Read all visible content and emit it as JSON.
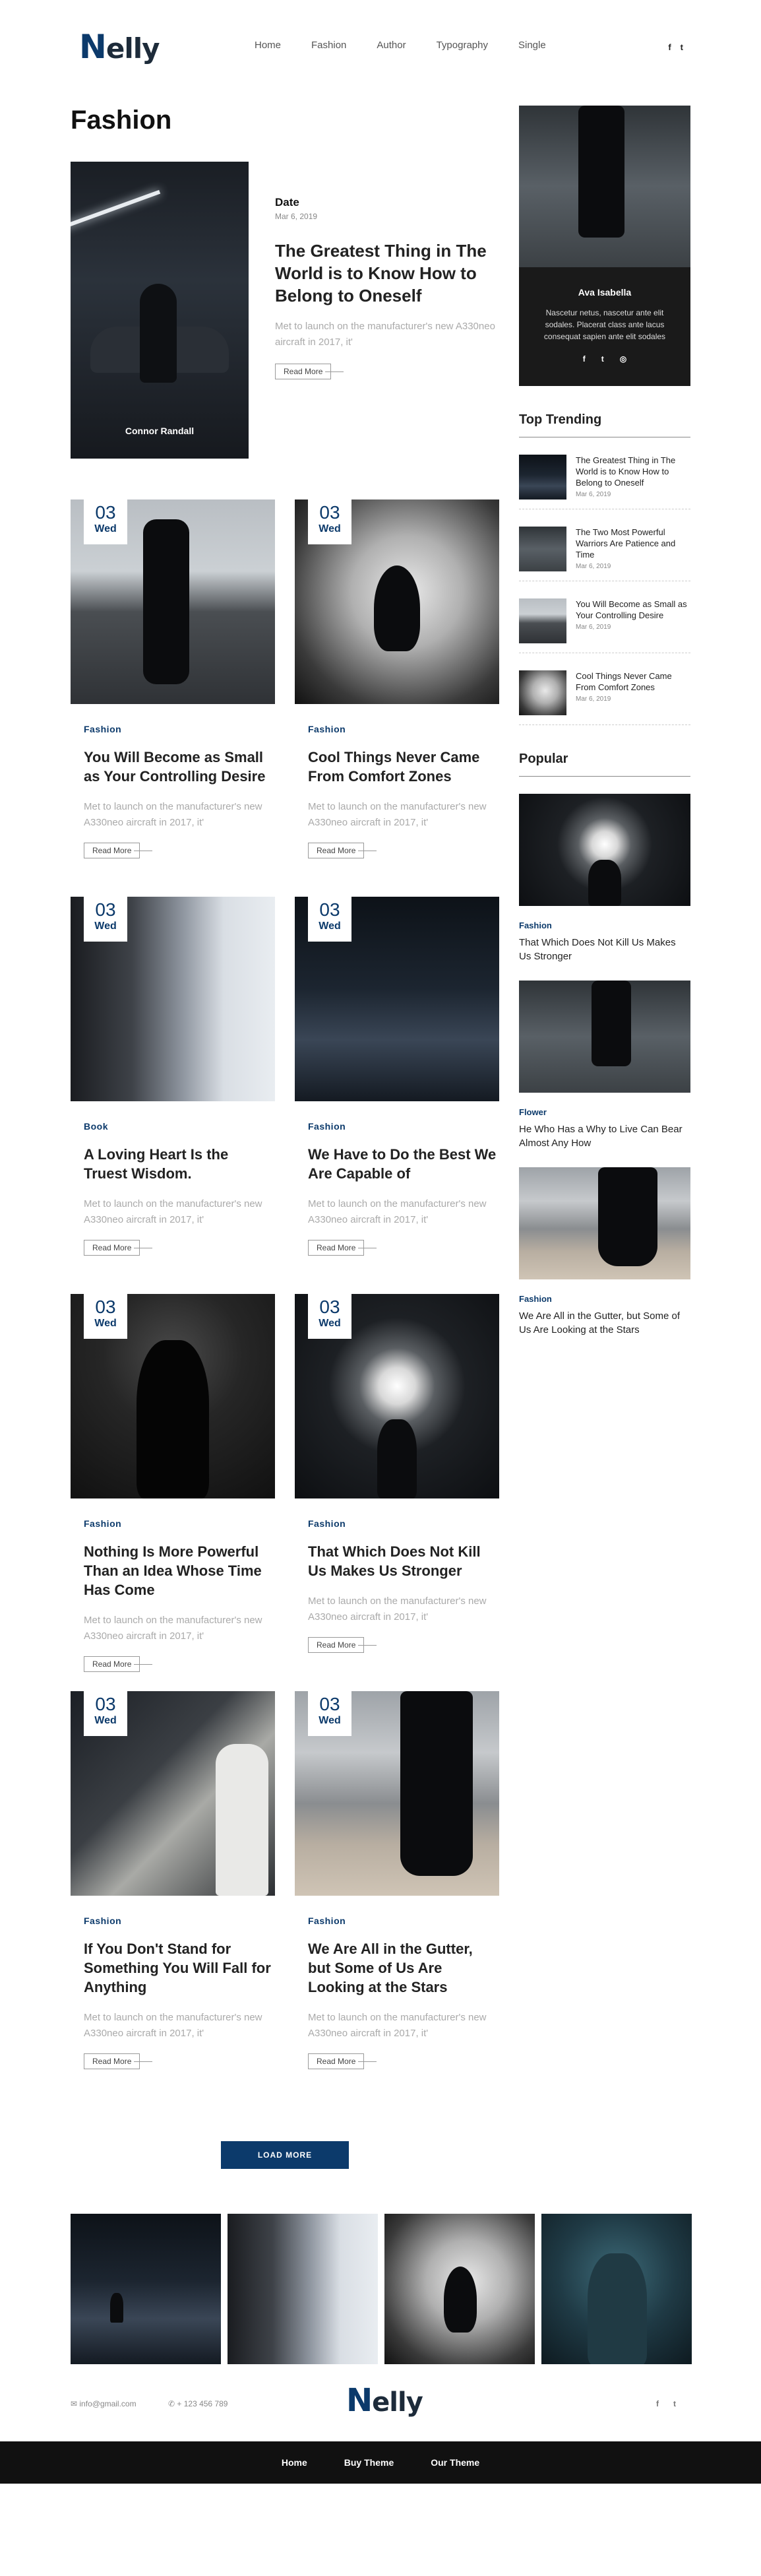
{
  "brand": {
    "logo_n": "N",
    "logo_rest": "elly"
  },
  "nav": [
    "Home",
    "Fashion",
    "Author",
    "Typography",
    "Single"
  ],
  "social_icons": [
    "f",
    "t"
  ],
  "page_title": "Fashion",
  "featured": {
    "caption": "Connor Randall",
    "date_label": "Date",
    "date": "Mar 6, 2019",
    "title": "The Greatest Thing in The World is to Know How to Belong to Oneself",
    "excerpt": "Met to launch on the manufacturer's new A330neo aircraft in 2017, it'",
    "button": "Read More"
  },
  "posts": [
    {
      "day": "03",
      "weekday": "Wed",
      "category": "Fashion",
      "title": "You Will Become as Small as Your Controlling Desire",
      "excerpt": "Met to launch on the manufacturer's new A330neo aircraft in 2017, it'",
      "button": "Read More",
      "image": "gimbal"
    },
    {
      "day": "03",
      "weekday": "Wed",
      "category": "Fashion",
      "title": "Cool Things Never Came From Comfort Zones",
      "excerpt": "Met to launch on the manufacturer's new A330neo aircraft in 2017, it'",
      "button": "Read More",
      "image": "dancer"
    },
    {
      "day": "03",
      "weekday": "Wed",
      "category": "Book",
      "title": "A Loving Heart Is the Truest Wisdom.",
      "excerpt": "Met to launch on the manufacturer's new A330neo aircraft in 2017, it'",
      "button": "Read More",
      "image": "sculpture"
    },
    {
      "day": "03",
      "weekday": "Wed",
      "category": "Fashion",
      "title": "We Have to Do the Best We Are Capable of",
      "excerpt": "Met to launch on the manufacturer's new A330neo aircraft in 2017, it'",
      "button": "Read More",
      "image": "street"
    },
    {
      "day": "03",
      "weekday": "Wed",
      "category": "Fashion",
      "title": "Nothing Is More Powerful Than an Idea Whose Time Has Come",
      "excerpt": "Met to launch on the manufacturer's new A330neo aircraft in 2017, it'",
      "button": "Read More",
      "image": "dark"
    },
    {
      "day": "03",
      "weekday": "Wed",
      "category": "Fashion",
      "title": "That Which Does Not Kill Us Makes Us Stronger",
      "excerpt": "Met to launch on the manufacturer's new A330neo aircraft in 2017, it'",
      "button": "Read More",
      "image": "tunnel"
    },
    {
      "day": "03",
      "weekday": "Wed",
      "category": "Fashion",
      "title": "If You Don't Stand for Something You Will Fall for Anything",
      "excerpt": "Met to launch on the manufacturer's new A330neo aircraft in 2017, it'",
      "button": "Read More",
      "image": "night"
    },
    {
      "day": "03",
      "weekday": "Wed",
      "category": "Fashion",
      "title": "We Are All in the Gutter, but Some of Us Are Looking at the Stars",
      "excerpt": "Met to launch on the manufacturer's new A330neo aircraft in 2017, it'",
      "button": "Read More",
      "image": "beach"
    }
  ],
  "load_more": "LOAD MORE",
  "profile": {
    "name": "Ava Isabella",
    "bio": "Nascetur netus, nascetur ante elit sodales. Placerat class ante lacus consequat sapien ante elit sodales",
    "social": [
      "f",
      "t",
      "◎"
    ]
  },
  "top_trending": {
    "heading": "Top Trending",
    "items": [
      {
        "title": "The Greatest Thing in The World is to Know How to Belong to Oneself",
        "date": "Mar 6, 2019",
        "image": "street"
      },
      {
        "title": "The Two Most Powerful Warriors Are Patience and Time",
        "date": "Mar 6, 2019",
        "image": "skate"
      },
      {
        "title": "You Will Become as Small as Your Controlling Desire",
        "date": "Mar 6, 2019",
        "image": "gimbal"
      },
      {
        "title": "Cool Things Never Came From Comfort Zones",
        "date": "Mar 6, 2019",
        "image": "dancer"
      }
    ]
  },
  "popular": {
    "heading": "Popular",
    "items": [
      {
        "category": "Fashion",
        "title": "That Which Does Not Kill Us Makes Us Stronger",
        "image": "tunnel"
      },
      {
        "category": "Flower",
        "title": "He Who Has a Why to Live Can Bear Almost Any How",
        "image": "skate"
      },
      {
        "category": "Fashion",
        "title": "We Are All in the Gutter, but Some of Us Are Looking at the Stars",
        "image": "beach"
      }
    ]
  },
  "instagram": [
    "street",
    "sculpture",
    "dancer",
    "blue"
  ],
  "footer": {
    "email": "info@gmail.com",
    "phone": "+ 123 456 789",
    "social": [
      "f",
      "t"
    ],
    "links": [
      "Home",
      "Buy Theme",
      "Our Theme"
    ]
  },
  "colors": {
    "accent": "#0c3a6b",
    "footer_bg": "#111111"
  }
}
